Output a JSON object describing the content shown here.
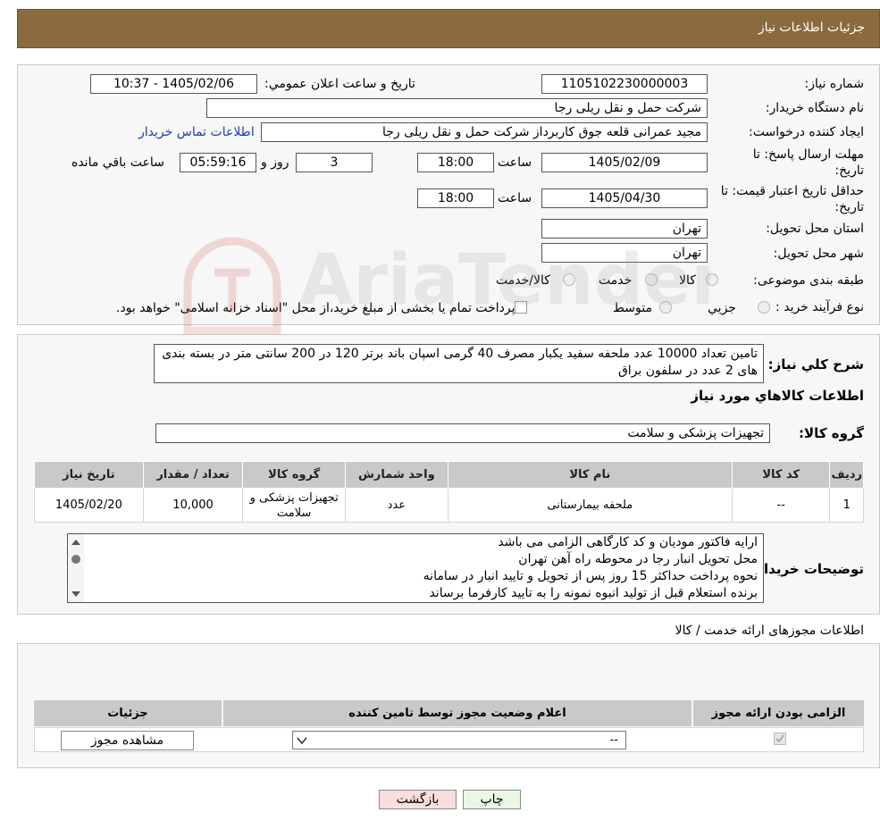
{
  "header": {
    "title": "جزئیات اطلاعات نیاز"
  },
  "form": {
    "need_number_label": "شماره نیاز:",
    "need_number": "1105102230000003",
    "announce_label": "تاریخ و ساعت اعلان عمومي:",
    "announce_value": "1405/02/06 - 10:37",
    "buyer_org_label": "نام دستگاه خریدار:",
    "buyer_org": "شرکت حمل و نقل ریلی رجا",
    "requester_label": "ایجاد کننده درخواست:",
    "requester": "مجید عمرانی قلعه جوق کاربرداز شرکت حمل و نقل ریلی رجا",
    "contact_link": "اطلاعات تماس خریدار",
    "deadline_label_1": "مهلت ارسال پاسخ: تا",
    "deadline_label_2": "تاریخ:",
    "deadline_date": "1405/02/09",
    "time_label": "ساعت",
    "deadline_time": "18:00",
    "days_value": "3",
    "days_label": "روز و",
    "remaining_time": "05:59:16",
    "remaining_label": "ساعت باقي مانده",
    "validity_label_1": "حداقل تاریخ اعتبار قیمت: تا",
    "validity_label_2": "تاریخ:",
    "validity_date": "1405/04/30",
    "validity_time": "18:00",
    "province_label": "استان محل تحویل:",
    "province": "تهران",
    "city_label": "شهر محل تحویل:",
    "city": "تهران",
    "category_label": "طبقه بندی موضوعی:",
    "category_options": [
      "کالا",
      "خدمت",
      "کالا/خدمت"
    ],
    "process_label": "نوع فرآیند خرید :",
    "process_options": [
      "جزيي",
      "متوسط"
    ],
    "process_note": "پرداخت تمام یا بخشی از مبلغ خرید،از محل \"اسناد خزانه اسلامی\" خواهد بود."
  },
  "description": {
    "label": "شرح کلي نیاز:",
    "text": "تامین تعداد 10000 عدد ملحفه سفید یکبار مصرف 40 گرمی اسپان باند برتر 120 در 200 سانتی متر در بسته بندی های 2 عدد در سلفون براق"
  },
  "goods": {
    "section_title": "اطلاعات کالاهاي مورد نیاز",
    "group_label": "گروه کالا:",
    "group_value": "تجهیزات پزشکی و سلامت",
    "columns": [
      "ردیف",
      "کد کالا",
      "نام کالا",
      "واحد شمارش",
      "گروه کالا",
      "تعداد / مقدار",
      "تاریخ نیاز"
    ],
    "rows": [
      [
        "1",
        "--",
        "ملحفه بیمارستانی",
        "عدد",
        "تجهیزات پزشکی و سلامت",
        "10,000",
        "1405/02/20"
      ]
    ]
  },
  "buyer_notes": {
    "label": "توضیحات خریدار:",
    "lines": [
      "ارایه فاکتور مودیان و کد کارگاهی الزامی می باشد",
      "محل تحویل انبار رجا در محوطه راه آهن تهران",
      "نحوه پرداخت حداکثر 15 روز پس از تحویل و تایید انبار در سامانه",
      "برنده استعلام قبل از تولید انبوه نمونه را به تایید کارفرما برساند"
    ]
  },
  "permits": {
    "section_title": "اطلاعات مجوزهای ارائه خدمت / کالا",
    "columns": [
      "الزامی بودن ارائه مجوز",
      "اعلام وضعیت مجوز توسط تامین کننده",
      "جزئیات"
    ],
    "select_value": "--",
    "view_button": "مشاهده مجوز"
  },
  "actions": {
    "print": "چاپ",
    "back": "بازگشت"
  },
  "watermark": {
    "text": "AriaTender.neT"
  },
  "colors": {
    "header_bg": "#8b6a3e",
    "link": "#1a3fb3",
    "back_btn": "#f9dede",
    "print_btn": "#e9f7e4"
  }
}
